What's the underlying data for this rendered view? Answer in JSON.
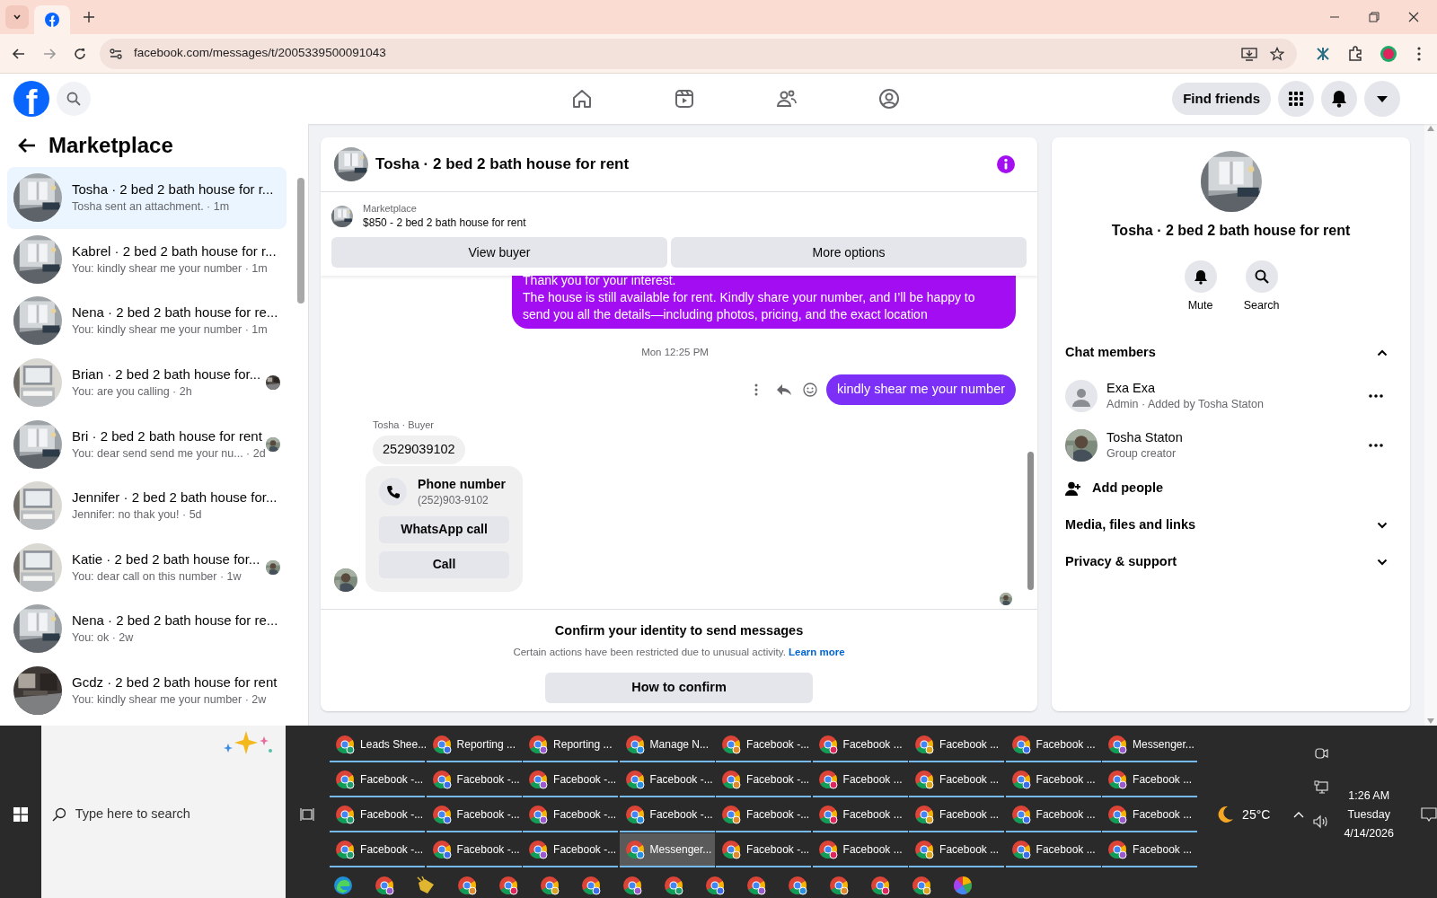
{
  "browser": {
    "url": "facebook.com/messages/t/2005339500091043"
  },
  "facebook": {
    "logo": "f",
    "find_friends": "Find friends",
    "nav": [
      {
        "kind": "home",
        "selected": false
      },
      {
        "kind": "video",
        "selected": false
      },
      {
        "kind": "friends",
        "selected": false
      },
      {
        "kind": "profile",
        "selected": false
      }
    ]
  },
  "sidebar": {
    "title": "Marketplace",
    "conversations": [
      {
        "title": "Tosha · 2 bed 2 bath house for r...",
        "preview": "Tosha sent an attachment. · 1m",
        "selected": true,
        "seen": false
      },
      {
        "title": "Kabrel · 2 bed 2 bath house for r...",
        "preview": "You: kindly shear me your number · 1m",
        "selected": false,
        "seen": false
      },
      {
        "title": "Nena · 2 bed 2 bath house for re...",
        "preview": "You: kindly shear me your number · 1m",
        "selected": false,
        "seen": false
      },
      {
        "title": "Brian · 2 bed 2 bath house for...",
        "preview": "You: are you calling · 2h",
        "selected": false,
        "seen": true
      },
      {
        "title": "Bri · 2 bed 2 bath house for rent",
        "preview": "You: dear send send me your nu...  · 2d",
        "selected": false,
        "seen": true
      },
      {
        "title": "Jennifer · 2 bed 2 bath house for...",
        "preview": "Jennifer: no thak you! · 5d",
        "selected": false,
        "seen": false
      },
      {
        "title": "Katie · 2 bed 2 bath house for...",
        "preview": "You: dear call on this number · 1w",
        "selected": false,
        "seen": true
      },
      {
        "title": "Nena · 2 bed 2 bath house for re...",
        "preview": "You: ok · 2w",
        "selected": false,
        "seen": false
      },
      {
        "title": "Gcdz · 2 bed 2 bath house for rent",
        "preview": "You: kindly shear me your number · 2w",
        "selected": false,
        "seen": false
      }
    ]
  },
  "chat": {
    "title": "Tosha · 2 bed 2 bath house for rent",
    "listing": {
      "source": "Marketplace",
      "item": "$850 - 2 bed 2 bath house for rent",
      "buttons": [
        "View buyer",
        "More options"
      ]
    },
    "messages": [
      {
        "kind": "outgoing",
        "lines": [
          "Thank you for your interest.",
          "The house is still available for rent. Kindly share your number, and I’ll be happy to",
          "send you all the details—including photos, pricing, and the exact location"
        ]
      },
      {
        "kind": "timestamp",
        "text": "Mon 12:25 PM"
      },
      {
        "kind": "outgoing_short",
        "text": "kindly shear me your number"
      },
      {
        "kind": "incoming",
        "sender": "Tosha · Buyer",
        "text": "2529039102"
      },
      {
        "kind": "contact_card",
        "title": "Phone number",
        "number": "(252)903-9102",
        "buttons": [
          "WhatsApp call",
          "Call"
        ]
      }
    ],
    "notice": {
      "title": "Confirm your identity to send messages",
      "text": "Certain actions have been restricted due to unusual activity.",
      "link": "Learn more",
      "button": "How to confirm"
    }
  },
  "details": {
    "title": "Tosha · 2 bed 2 bath house for rent",
    "actions": [
      {
        "kind": "mute",
        "label": "Mute"
      },
      {
        "kind": "search",
        "label": "Search"
      }
    ],
    "sections": [
      {
        "title": "Chat members",
        "expanded": true
      },
      {
        "title": "Media, files and links",
        "expanded": false
      },
      {
        "title": "Privacy & support",
        "expanded": false
      }
    ],
    "members": [
      {
        "name": "Exa Exa",
        "role": "Admin · Added by Tosha Staton",
        "kind": "silhouette"
      },
      {
        "name": "Tosha Staton",
        "role": "Group creator",
        "kind": "picture"
      }
    ],
    "add_people": "Add people"
  },
  "taskbar": {
    "search_placeholder": "Type here to search",
    "windows": [
      {
        "label": "Leads Shee...",
        "selected": false
      },
      {
        "label": "Reporting ...",
        "selected": false
      },
      {
        "label": "Reporting ...",
        "selected": false
      },
      {
        "label": "Manage N...",
        "selected": false
      },
      {
        "label": "Facebook -...",
        "selected": false
      },
      {
        "label": "Facebook ...",
        "selected": false
      },
      {
        "label": "Facebook ...",
        "selected": false
      },
      {
        "label": "Facebook ...",
        "selected": false
      },
      {
        "label": "Messenger...",
        "selected": false
      },
      {
        "label": "Facebook -...",
        "selected": false
      },
      {
        "label": "Facebook -...",
        "selected": false
      },
      {
        "label": "Facebook -...",
        "selected": false
      },
      {
        "label": "Facebook -...",
        "selected": false
      },
      {
        "label": "Facebook -...",
        "selected": false
      },
      {
        "label": "Facebook ...",
        "selected": false
      },
      {
        "label": "Facebook ...",
        "selected": false
      },
      {
        "label": "Facebook ...",
        "selected": false
      },
      {
        "label": "Facebook ...",
        "selected": false
      },
      {
        "label": "Facebook -...",
        "selected": false
      },
      {
        "label": "Facebook -...",
        "selected": false
      },
      {
        "label": "Facebook -...",
        "selected": false
      },
      {
        "label": "Facebook -...",
        "selected": false
      },
      {
        "label": "Facebook -...",
        "selected": false
      },
      {
        "label": "Facebook ...",
        "selected": false
      },
      {
        "label": "Facebook ...",
        "selected": false
      },
      {
        "label": "Facebook ...",
        "selected": false
      },
      {
        "label": "Facebook ...",
        "selected": false
      },
      {
        "label": "Facebook -...",
        "selected": false
      },
      {
        "label": "Facebook -...",
        "selected": false
      },
      {
        "label": "Facebook -...",
        "selected": false
      },
      {
        "label": "Messenger...",
        "selected": true
      },
      {
        "label": "Facebook -...",
        "selected": false
      },
      {
        "label": "Facebook ...",
        "selected": false
      },
      {
        "label": "Facebook ...",
        "selected": false
      },
      {
        "label": "Facebook ...",
        "selected": false
      },
      {
        "label": "Facebook ...",
        "selected": false
      }
    ],
    "temperature": "25°C",
    "time": "1:26 AM",
    "day": "Tuesday",
    "date": "4/14/2026"
  }
}
